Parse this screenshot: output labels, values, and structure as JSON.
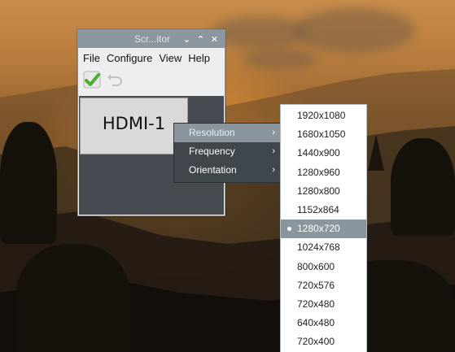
{
  "window": {
    "title": "Scr...itor",
    "controls": {
      "minimize": "⌄",
      "maximize": "⌃",
      "close": "✕"
    }
  },
  "menubar": {
    "file": "File",
    "configure": "Configure",
    "view": "View",
    "help": "Help"
  },
  "toolbar": {
    "apply_icon": "checkmark-icon",
    "undo_icon": "undo-icon"
  },
  "display": {
    "label": "HDMI-1"
  },
  "context_menu": {
    "items": [
      {
        "label": "Resolution",
        "arrow": "›"
      },
      {
        "label": "Frequency",
        "arrow": "›"
      },
      {
        "label": "Orientation",
        "arrow": "›"
      }
    ]
  },
  "resolutions": {
    "selected": "1280x720",
    "items": [
      "1920x1080",
      "1680x1050",
      "1440x900",
      "1280x960",
      "1280x800",
      "1152x864",
      "1280x720",
      "1024x768",
      "800x600",
      "720x576",
      "720x480",
      "640x480",
      "720x400"
    ]
  },
  "colors": {
    "titlebar": "#8c969e",
    "menu_dark": "#3f464c",
    "highlight": "#8b959d",
    "check_green": "#4caf2f"
  }
}
